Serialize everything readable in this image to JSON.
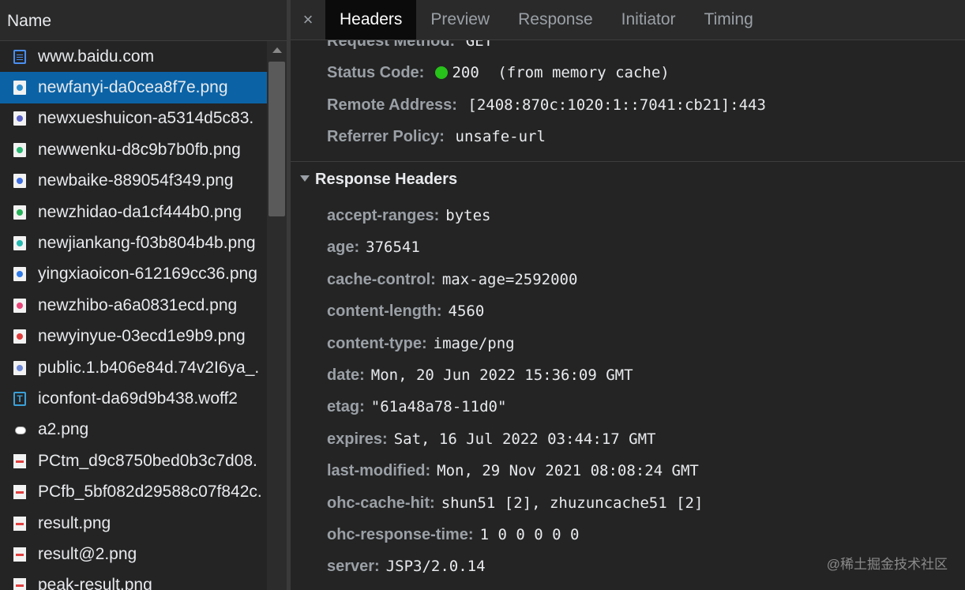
{
  "left_panel": {
    "header": "Name",
    "files": [
      {
        "name": "www.baidu.com",
        "icon": "document-icon",
        "type": "doc"
      },
      {
        "name": "newfanyi-da0cea8f7e.png",
        "icon": "image-icon",
        "type": "img",
        "color": "#2d8fd0",
        "selected": true
      },
      {
        "name": "newxueshuicon-a5314d5c83.",
        "icon": "image-icon",
        "type": "img",
        "color": "#5a62c8"
      },
      {
        "name": "newwenku-d8c9b7b0fb.png",
        "icon": "image-icon",
        "type": "img",
        "color": "#2bb673"
      },
      {
        "name": "newbaike-889054f349.png",
        "icon": "image-icon",
        "type": "img",
        "color": "#3f6fe0"
      },
      {
        "name": "newzhidao-da1cf444b0.png",
        "icon": "image-icon",
        "type": "img",
        "color": "#27b35a"
      },
      {
        "name": "newjiankang-f03b804b4b.png",
        "icon": "image-icon",
        "type": "img",
        "color": "#25b8b0"
      },
      {
        "name": "yingxiaoicon-612169cc36.png",
        "icon": "image-icon",
        "type": "img",
        "color": "#2f7be8"
      },
      {
        "name": "newzhibo-a6a0831ecd.png",
        "icon": "image-icon",
        "type": "img",
        "color": "#e8457a"
      },
      {
        "name": "newyinyue-03ecd1e9b9.png",
        "icon": "image-icon",
        "type": "img",
        "color": "#e03c3c"
      },
      {
        "name": "public.1.b406e84d.74v2I6ya_.",
        "icon": "image-icon",
        "type": "img",
        "color": "#6f8ad8"
      },
      {
        "name": "iconfont-da69d9b438.woff2",
        "icon": "font-icon",
        "type": "font"
      },
      {
        "name": "a2.png",
        "icon": "cloud-image-icon",
        "type": "cloud"
      },
      {
        "name": "PCtm_d9c8750bed0b3c7d08.",
        "icon": "image-icon",
        "type": "bar"
      },
      {
        "name": "PCfb_5bf082d29588c07f842c.",
        "icon": "image-icon",
        "type": "bar"
      },
      {
        "name": "result.png",
        "icon": "image-icon",
        "type": "bar"
      },
      {
        "name": "result@2.png",
        "icon": "image-icon",
        "type": "bar"
      },
      {
        "name": "peak-result.png",
        "icon": "image-icon",
        "type": "bar"
      }
    ]
  },
  "tabs": {
    "close": "×",
    "items": [
      {
        "label": "Headers",
        "active": true
      },
      {
        "label": "Preview"
      },
      {
        "label": "Response"
      },
      {
        "label": "Initiator"
      },
      {
        "label": "Timing"
      }
    ]
  },
  "general": {
    "request_method": {
      "key": "Request Method:",
      "value": "GET"
    },
    "status_code": {
      "key": "Status Code:",
      "value": "200",
      "note": "(from memory cache)",
      "dot_color": "#27c21a"
    },
    "remote_address": {
      "key": "Remote Address:",
      "value": "[2408:870c:1020:1::7041:cb21]:443"
    },
    "referrer_policy": {
      "key": "Referrer Policy:",
      "value": "unsafe-url"
    }
  },
  "response_headers": {
    "title": "Response Headers",
    "items": [
      {
        "key": "accept-ranges:",
        "value": "bytes"
      },
      {
        "key": "age:",
        "value": "376541"
      },
      {
        "key": "cache-control:",
        "value": "max-age=2592000"
      },
      {
        "key": "content-length:",
        "value": "4560"
      },
      {
        "key": "content-type:",
        "value": "image/png"
      },
      {
        "key": "date:",
        "value": "Mon, 20 Jun 2022 15:36:09 GMT"
      },
      {
        "key": "etag:",
        "value": "\"61a48a78-11d0\""
      },
      {
        "key": "expires:",
        "value": "Sat, 16 Jul 2022 03:44:17 GMT"
      },
      {
        "key": "last-modified:",
        "value": "Mon, 29 Nov 2021 08:08:24 GMT"
      },
      {
        "key": "ohc-cache-hit:",
        "value": "shun51 [2], zhuzuncache51 [2]"
      },
      {
        "key": "ohc-response-time:",
        "value": "1 0 0 0 0 0"
      },
      {
        "key": "server:",
        "value": "JSP3/2.0.14"
      }
    ]
  },
  "watermark": "@稀土掘金技术社区"
}
